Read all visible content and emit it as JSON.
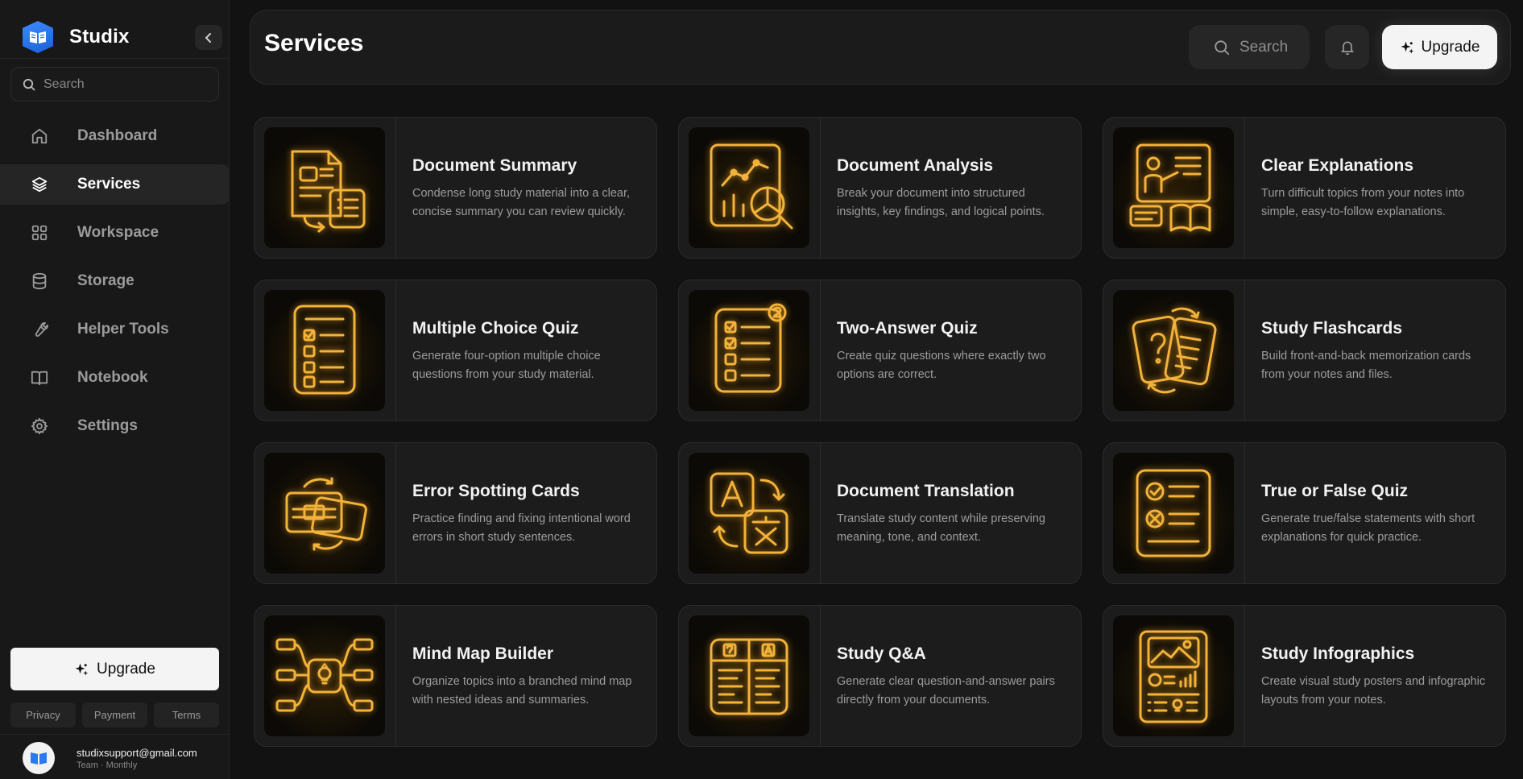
{
  "app": {
    "name": "Studix"
  },
  "sidebar": {
    "search_placeholder": "Search",
    "items": [
      {
        "label": "Dashboard",
        "icon": "home-icon",
        "active": false
      },
      {
        "label": "Services",
        "icon": "layers-icon",
        "active": true
      },
      {
        "label": "Workspace",
        "icon": "grid-icon",
        "active": false
      },
      {
        "label": "Storage",
        "icon": "database-icon",
        "active": false
      },
      {
        "label": "Helper Tools",
        "icon": "wrench-icon",
        "active": false
      },
      {
        "label": "Notebook",
        "icon": "book-icon",
        "active": false
      },
      {
        "label": "Settings",
        "icon": "gear-icon",
        "active": false
      }
    ],
    "upgrade_label": "Upgrade",
    "footer_links": [
      "Privacy",
      "Payment",
      "Terms"
    ],
    "user": {
      "email": "studixsupport@gmail.com",
      "plan": "Team · Monthly"
    }
  },
  "header": {
    "title": "Services",
    "search_label": "Search",
    "upgrade_label": "Upgrade"
  },
  "services": [
    {
      "title": "Document Summary",
      "description": "Condense long study material into a clear, concise summary you can review quickly.",
      "icon": "document-summary-icon"
    },
    {
      "title": "Document Analysis",
      "description": "Break your document into structured insights, key findings, and logical points.",
      "icon": "chart-magnifier-icon"
    },
    {
      "title": "Clear Explanations",
      "description": "Turn difficult topics from your notes into simple, easy-to-follow explanations.",
      "icon": "teacher-board-icon"
    },
    {
      "title": "Multiple Choice Quiz",
      "description": "Generate four-option multiple choice questions from your study material.",
      "icon": "checklist-icon"
    },
    {
      "title": "Two-Answer Quiz",
      "description": "Create quiz questions where exactly two options are correct.",
      "icon": "two-checks-icon"
    },
    {
      "title": "Study Flashcards",
      "description": "Build front-and-back memorization cards from your notes and files.",
      "icon": "flashcards-icon"
    },
    {
      "title": "Error Spotting Cards",
      "description": "Practice finding and fixing intentional word errors in short study sentences.",
      "icon": "swap-cards-icon"
    },
    {
      "title": "Document Translation",
      "description": "Translate study content while preserving meaning, tone, and context.",
      "icon": "translate-icon"
    },
    {
      "title": "True or False Quiz",
      "description": "Generate true/false statements with short explanations for quick practice.",
      "icon": "true-false-icon"
    },
    {
      "title": "Mind Map Builder",
      "description": "Organize topics into a branched mind map with nested ideas and summaries.",
      "icon": "mind-map-icon"
    },
    {
      "title": "Study Q&A",
      "description": "Generate clear question-and-answer pairs directly from your documents.",
      "icon": "qa-icon"
    },
    {
      "title": "Study Infographics",
      "description": "Create visual study posters and infographic layouts from your notes.",
      "icon": "infographic-icon"
    }
  ],
  "colors": {
    "accent_gold": "#f3b23a",
    "brand_blue": "#2b78f0",
    "background": "#121212"
  }
}
